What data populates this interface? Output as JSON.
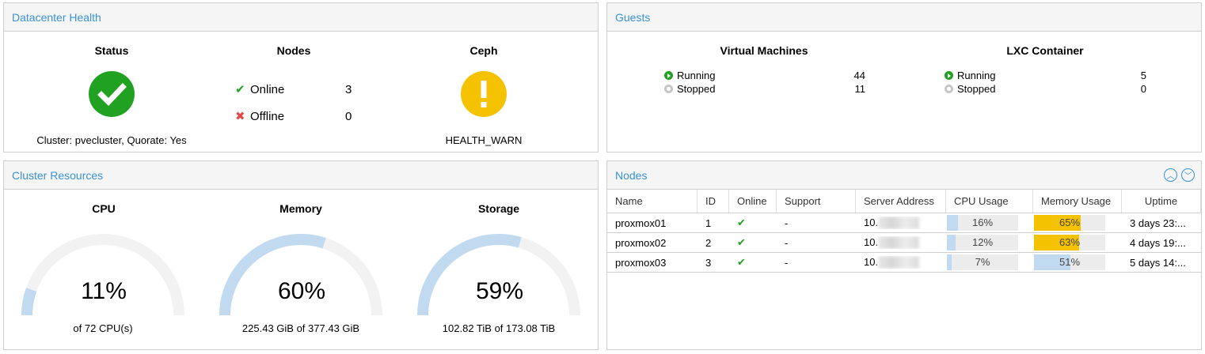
{
  "datacenter": {
    "title": "Datacenter Health",
    "status": {
      "heading": "Status",
      "icon": "check-circle-icon",
      "text": "Cluster: pvecluster, Quorate: Yes"
    },
    "nodes": {
      "heading": "Nodes",
      "online_label": "Online",
      "online_count": "3",
      "offline_label": "Offline",
      "offline_count": "0"
    },
    "ceph": {
      "heading": "Ceph",
      "icon": "warning-circle-icon",
      "text": "HEALTH_WARN"
    }
  },
  "guests": {
    "title": "Guests",
    "vm": {
      "heading": "Virtual Machines",
      "running_label": "Running",
      "running": "44",
      "stopped_label": "Stopped",
      "stopped": "11"
    },
    "lxc": {
      "heading": "LXC Container",
      "running_label": "Running",
      "running": "5",
      "stopped_label": "Stopped",
      "stopped": "0"
    }
  },
  "resources": {
    "title": "Cluster Resources",
    "cpu": {
      "heading": "CPU",
      "value": "11%",
      "fraction": 0.11,
      "sub": "of 72 CPU(s)"
    },
    "memory": {
      "heading": "Memory",
      "value": "60%",
      "fraction": 0.6,
      "sub": "225.43 GiB of 377.43 GiB"
    },
    "storage": {
      "heading": "Storage",
      "value": "59%",
      "fraction": 0.59,
      "sub": "102.82 TiB of 173.08 TiB"
    }
  },
  "nodes_grid": {
    "title": "Nodes",
    "columns": {
      "name": "Name",
      "id": "ID",
      "online": "Online",
      "support": "Support",
      "addr": "Server Address",
      "cpu": "CPU Usage",
      "mem": "Memory Usage",
      "uptime": "Uptime"
    },
    "rows": [
      {
        "name": "proxmox01",
        "id": "1",
        "support": "-",
        "addr": "10.",
        "cpu": "16%",
        "cpu_frac": 0.16,
        "mem": "65%",
        "mem_frac": 0.65,
        "uptime": "3 days 23:..."
      },
      {
        "name": "proxmox02",
        "id": "2",
        "support": "-",
        "addr": "10.",
        "cpu": "12%",
        "cpu_frac": 0.12,
        "mem": "63%",
        "mem_frac": 0.63,
        "uptime": "4 days 19:..."
      },
      {
        "name": "proxmox03",
        "id": "3",
        "support": "-",
        "addr": "10.",
        "cpu": "7%",
        "cpu_frac": 0.07,
        "mem": "51%",
        "mem_frac": 0.51,
        "uptime": "5 days 14:..."
      }
    ]
  },
  "colors": {
    "accent": "#3892d4",
    "ok": "#21a121",
    "warn": "#f5c200",
    "bar_normal": "#c2daf0",
    "bar_warn": "#f5c200",
    "error": "#e24a4a"
  }
}
